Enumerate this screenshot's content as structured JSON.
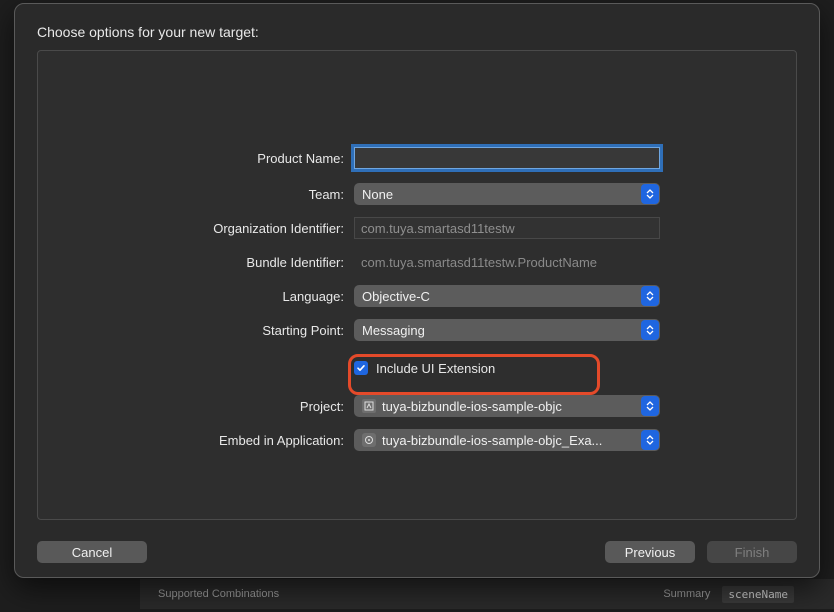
{
  "sheet": {
    "title": "Choose options for your new target:"
  },
  "form": {
    "product_name": {
      "label": "Product Name:",
      "value": ""
    },
    "team": {
      "label": "Team:",
      "selected": "None"
    },
    "org_identifier": {
      "label": "Organization Identifier:",
      "value": "com.tuya.smartasd11testw"
    },
    "bundle_identifier": {
      "label": "Bundle Identifier:",
      "value": "com.tuya.smartasd11testw.ProductName"
    },
    "language": {
      "label": "Language:",
      "selected": "Objective-C"
    },
    "starting_point": {
      "label": "Starting Point:",
      "selected": "Messaging"
    },
    "include_ui_extension": {
      "label": "Include UI Extension",
      "checked": true
    },
    "project": {
      "label": "Project:",
      "selected": "tuya-bizbundle-ios-sample-objc"
    },
    "embed_in_application": {
      "label": "Embed in Application:",
      "selected": "tuya-bizbundle-ios-sample-objc_Exa..."
    }
  },
  "buttons": {
    "cancel": "Cancel",
    "previous": "Previous",
    "finish": "Finish"
  },
  "background": {
    "supported_combinations": "Supported Combinations",
    "summary": "Summary",
    "scene_name": "sceneName"
  }
}
